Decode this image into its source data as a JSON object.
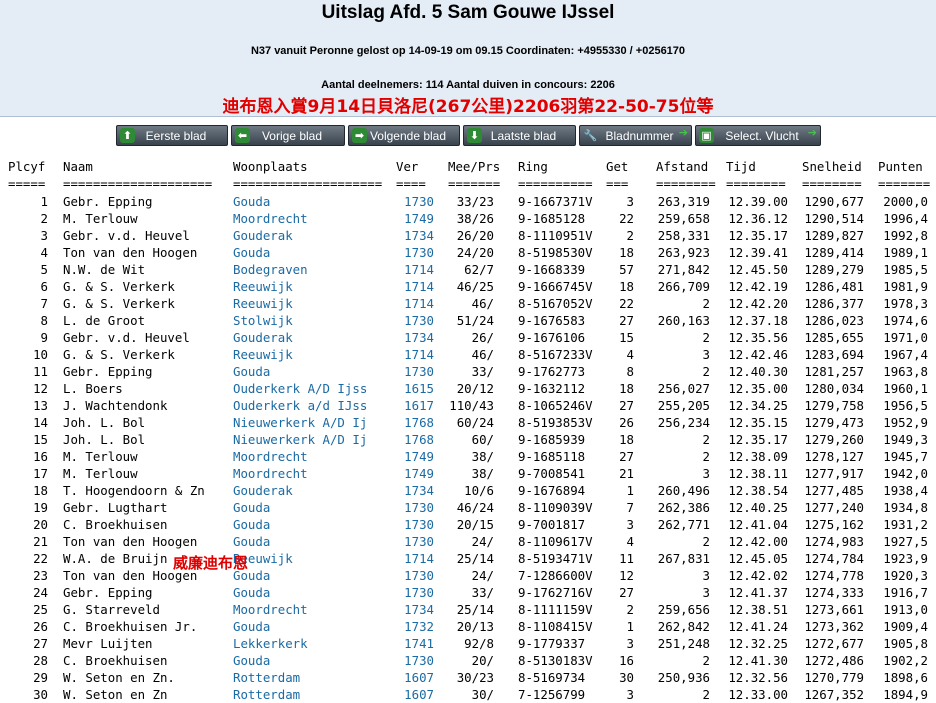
{
  "header": {
    "title": "Uitslag Afd. 5 Sam Gouwe IJssel",
    "flight_info": "N37 vanuit Peronne gelost op 14-09-19 om 09.15 Coordinaten: +4955330 / +0256170",
    "participants": "Aantal deelnemers: 114 Aantal duiven in concours: 2206",
    "chinese_note": "迪布恩入賞9月14日貝洛尼(267公里)2206羽第22-50-75位等"
  },
  "nav": {
    "buttons": [
      {
        "label": "Eerste blad",
        "icon": "up-arrow-icon"
      },
      {
        "label": "Vorige blad",
        "icon": "left-arrow-icon"
      },
      {
        "label": "Volgende blad",
        "icon": "right-arrow-icon"
      },
      {
        "label": "Laatste blad",
        "icon": "down-arrow-icon"
      },
      {
        "label": "Bladnummer",
        "icon": "wrench-icon"
      },
      {
        "label": "Select. Vlucht",
        "icon": "save-icon"
      }
    ]
  },
  "overlay_note": "威廉迪布恩",
  "table": {
    "headers": [
      "Plcyf",
      "Naam",
      "Woonplaats",
      "Ver",
      "Mee/Prs",
      "Ring",
      "Get",
      "Afstand",
      "Tijd",
      "Snelheid",
      "Punten"
    ],
    "separators": [
      "=====",
      "====================",
      "====================",
      "====",
      "=======",
      "==========",
      "===",
      "========",
      "========",
      "========",
      "======="
    ],
    "rows": [
      [
        "1",
        "Gebr. Epping",
        "Gouda",
        "1730",
        "33/23",
        "9-1667371V",
        "3",
        "263,319",
        "12.39.00",
        "1290,677",
        "2000,0"
      ],
      [
        "2",
        "M. Terlouw",
        "Moordrecht",
        "1749",
        "38/26",
        "9-1685128",
        "22",
        "259,658",
        "12.36.12",
        "1290,514",
        "1996,4"
      ],
      [
        "3",
        "Gebr. v.d. Heuvel",
        "Gouderak",
        "1734",
        "26/20",
        "8-1110951V",
        "2",
        "258,331",
        "12.35.17",
        "1289,827",
        "1992,8"
      ],
      [
        "4",
        "Ton van den Hoogen",
        "Gouda",
        "1730",
        "24/20",
        "8-5198530V",
        "18",
        "263,923",
        "12.39.41",
        "1289,414",
        "1989,1"
      ],
      [
        "5",
        "N.W. de Wit",
        "Bodegraven",
        "1714",
        "62/7",
        "9-1668339",
        "57",
        "271,842",
        "12.45.50",
        "1289,279",
        "1985,5"
      ],
      [
        "6",
        "G. & S. Verkerk",
        "Reeuwijk",
        "1714",
        "46/25",
        "9-1666745V",
        "18",
        "266,709",
        "12.42.19",
        "1286,481",
        "1981,9"
      ],
      [
        "7",
        "G. & S. Verkerk",
        "Reeuwijk",
        "1714",
        "46/",
        "8-5167052V",
        "22",
        "2",
        "12.42.20",
        "1286,377",
        "1978,3"
      ],
      [
        "8",
        "L. de Groot",
        "Stolwijk",
        "1730",
        "51/24",
        "9-1676583",
        "27",
        "260,163",
        "12.37.18",
        "1286,023",
        "1974,6"
      ],
      [
        "9",
        "Gebr. v.d. Heuvel",
        "Gouderak",
        "1734",
        "26/",
        "9-1676106",
        "15",
        "2",
        "12.35.56",
        "1285,655",
        "1971,0"
      ],
      [
        "10",
        "G. & S. Verkerk",
        "Reeuwijk",
        "1714",
        "46/",
        "8-5167233V",
        "4",
        "3",
        "12.42.46",
        "1283,694",
        "1967,4"
      ],
      [
        "11",
        "Gebr. Epping",
        "Gouda",
        "1730",
        "33/",
        "9-1762773",
        "8",
        "2",
        "12.40.30",
        "1281,257",
        "1963,8"
      ],
      [
        "12",
        "L. Boers",
        "Ouderkerk A/D Ijss",
        "1615",
        "20/12",
        "9-1632112",
        "18",
        "256,027",
        "12.35.00",
        "1280,034",
        "1960,1"
      ],
      [
        "13",
        "J. Wachtendonk",
        "Ouderkerk a/d IJss",
        "1617",
        "110/43",
        "8-1065246V",
        "27",
        "255,205",
        "12.34.25",
        "1279,758",
        "1956,5"
      ],
      [
        "14",
        "Joh. L. Bol",
        "Nieuwerkerk A/D Ij",
        "1768",
        "60/24",
        "8-5193853V",
        "26",
        "256,234",
        "12.35.15",
        "1279,473",
        "1952,9"
      ],
      [
        "15",
        "Joh. L. Bol",
        "Nieuwerkerk A/D Ij",
        "1768",
        "60/",
        "9-1685939",
        "18",
        "2",
        "12.35.17",
        "1279,260",
        "1949,3"
      ],
      [
        "16",
        "M. Terlouw",
        "Moordrecht",
        "1749",
        "38/",
        "9-1685118",
        "27",
        "2",
        "12.38.09",
        "1278,127",
        "1945,7"
      ],
      [
        "17",
        "M. Terlouw",
        "Moordrecht",
        "1749",
        "38/",
        "9-7008541",
        "21",
        "3",
        "12.38.11",
        "1277,917",
        "1942,0"
      ],
      [
        "18",
        "T. Hoogendoorn & Zn",
        "Gouderak",
        "1734",
        "10/6",
        "9-1676894",
        "1",
        "260,496",
        "12.38.54",
        "1277,485",
        "1938,4"
      ],
      [
        "19",
        "Gebr. Lugthart",
        "Gouda",
        "1730",
        "46/24",
        "8-1109039V",
        "7",
        "262,386",
        "12.40.25",
        "1277,240",
        "1934,8"
      ],
      [
        "20",
        "C. Broekhuisen",
        "Gouda",
        "1730",
        "20/15",
        "9-7001817",
        "3",
        "262,771",
        "12.41.04",
        "1275,162",
        "1931,2"
      ],
      [
        "21",
        "Ton van den Hoogen",
        "Gouda",
        "1730",
        "24/",
        "8-1109617V",
        "4",
        "2",
        "12.42.00",
        "1274,983",
        "1927,5"
      ],
      [
        "22",
        "W.A. de Bruijn",
        "Reeuwijk",
        "1714",
        "25/14",
        "8-5193471V",
        "11",
        "267,831",
        "12.45.05",
        "1274,784",
        "1923,9"
      ],
      [
        "23",
        "Ton van den Hoogen",
        "Gouda",
        "1730",
        "24/",
        "7-1286600V",
        "12",
        "3",
        "12.42.02",
        "1274,778",
        "1920,3"
      ],
      [
        "24",
        "Gebr. Epping",
        "Gouda",
        "1730",
        "33/",
        "9-1762716V",
        "27",
        "3",
        "12.41.37",
        "1274,333",
        "1916,7"
      ],
      [
        "25",
        "G. Starreveld",
        "Moordrecht",
        "1734",
        "25/14",
        "8-1111159V",
        "2",
        "259,656",
        "12.38.51",
        "1273,661",
        "1913,0"
      ],
      [
        "26",
        "C. Broekhuisen Jr.",
        "Gouda",
        "1732",
        "20/13",
        "8-1108415V",
        "1",
        "262,842",
        "12.41.24",
        "1273,362",
        "1909,4"
      ],
      [
        "27",
        "Mevr Luijten",
        "Lekkerkerk",
        "1741",
        "92/8",
        "9-1779337",
        "3",
        "251,248",
        "12.32.25",
        "1272,677",
        "1905,8"
      ],
      [
        "28",
        "C. Broekhuisen",
        "Gouda",
        "1730",
        "20/",
        "8-5130183V",
        "16",
        "2",
        "12.41.30",
        "1272,486",
        "1902,2"
      ],
      [
        "29",
        "W. Seton en Zn.",
        "Rotterdam",
        "1607",
        "30/23",
        "8-5169734",
        "30",
        "250,936",
        "12.32.56",
        "1270,779",
        "1898,6"
      ],
      [
        "30",
        "W. Seton en Zn",
        "Rotterdam",
        "1607",
        "30/",
        "7-1256799",
        "3",
        "2",
        "12.33.00",
        "1267,352",
        "1894,9"
      ]
    ]
  }
}
